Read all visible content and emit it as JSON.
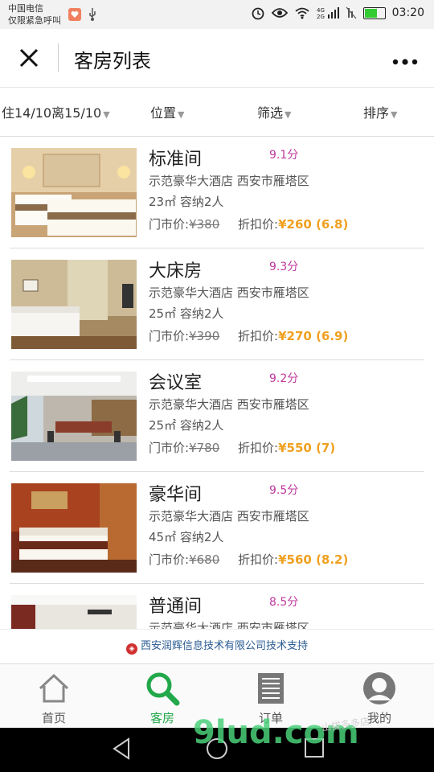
{
  "status": {
    "carrier": "中国电信",
    "emergency": "仅限紧急呼叫",
    "time": "03:20"
  },
  "header": {
    "title": "客房列表"
  },
  "filters": [
    {
      "label": "住14/10离15/10"
    },
    {
      "label": "位置"
    },
    {
      "label": "筛选"
    },
    {
      "label": "排序"
    }
  ],
  "rooms": [
    {
      "name": "标准间",
      "score": "9.1分",
      "hotel": "示范豪华大酒店 西安市雁塔区",
      "spec": "23㎡ 容纳2人",
      "orig_label": "门市价:",
      "orig": "¥380",
      "disc_label": "折扣价:",
      "disc": "¥260 (6.8)"
    },
    {
      "name": "大床房",
      "score": "9.3分",
      "hotel": "示范豪华大酒店 西安市雁塔区",
      "spec": "25㎡ 容纳2人",
      "orig_label": "门市价:",
      "orig": "¥390",
      "disc_label": "折扣价:",
      "disc": "¥270 (6.9)"
    },
    {
      "name": "会议室",
      "score": "9.2分",
      "hotel": "示范豪华大酒店 西安市雁塔区",
      "spec": "25㎡ 容纳2人",
      "orig_label": "门市价:",
      "orig": "¥780",
      "disc_label": "折扣价:",
      "disc": "¥550 (7)"
    },
    {
      "name": "豪华间",
      "score": "9.5分",
      "hotel": "示范豪华大酒店 西安市雁塔区",
      "spec": "45㎡ 容纳2人",
      "orig_label": "门市价:",
      "orig": "¥680",
      "disc_label": "折扣价:",
      "disc": "¥560 (8.2)"
    },
    {
      "name": "普通间",
      "score": "8.5分",
      "hotel": "示范豪华大酒店 西安市雁塔区",
      "spec": "",
      "orig_label": "",
      "orig": "",
      "disc_label": "",
      "disc": ""
    }
  ],
  "support": {
    "text": "西安润辉信息技术有限公司技术支持"
  },
  "tabs": [
    {
      "label": "首页",
      "icon": "home-icon"
    },
    {
      "label": "客房",
      "icon": "search-icon"
    },
    {
      "label": "订单",
      "icon": "list-icon"
    },
    {
      "label": "我的",
      "icon": "user-icon"
    }
  ],
  "watermark": {
    "brand": "9lud.com",
    "small": "山拔多多店"
  },
  "colors": {
    "active_tab": "#22a84a",
    "score": "#c0399c",
    "discount": "#f0a020",
    "support_link": "#2a5b92"
  }
}
